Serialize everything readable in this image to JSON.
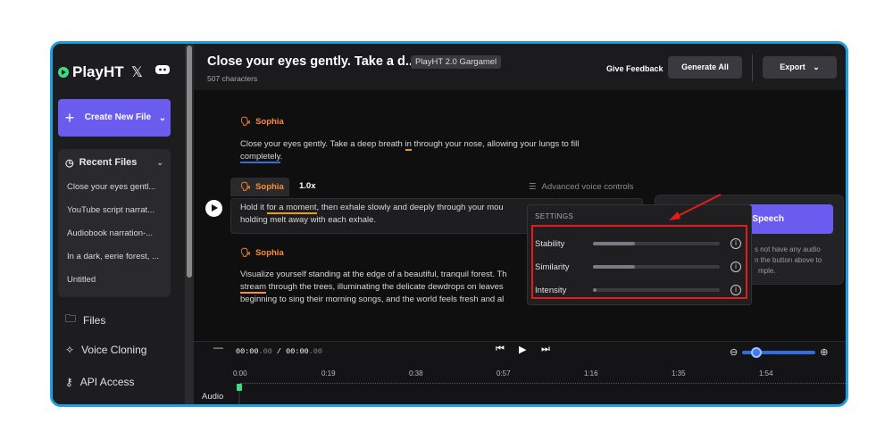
{
  "sidebar": {
    "brand": "PlayHT",
    "create_label": "Create New File",
    "recent_title": "Recent Files",
    "recent_files": [
      "Close your eyes gentl...",
      "YouTube script narrat...",
      "Audiobook narration-...",
      "In a dark, eerie forest, ...",
      "Untitled"
    ],
    "nav": [
      "Files",
      "Voice Cloning",
      "API Access"
    ]
  },
  "header": {
    "title": "Close your eyes gently. Take a d...",
    "model": "PlayHT 2.0 Gargamel",
    "char_count": "507 characters",
    "feedback": "Give Feedback",
    "generate_all": "Generate All",
    "export": "Export"
  },
  "editor": {
    "blocks": [
      {
        "speaker": "Sophia",
        "parts": [
          "Close your eyes gently. Take a deep breath ",
          "in",
          " through your nose, allowing your lungs to fill",
          "completely",
          "."
        ]
      },
      {
        "speaker": "Sophia",
        "speed": "1.0x",
        "parts": [
          "Hold it ",
          "for a moment",
          ", then exhale slowly and deeply through your mou",
          "holding melt away with each exhale."
        ]
      },
      {
        "speaker": "Sophia",
        "parts": [
          "Visualize yourself standing at the edge of a beautiful, tranquil forest. Th",
          "stream",
          " through the trees, illuminating the delicate dewdrops on leaves",
          "beginning to sing their morning songs, and the world feels fresh and al"
        ]
      }
    ],
    "advanced_controls": "Advanced voice controls"
  },
  "right_panel": {
    "button": "Speech",
    "hint_lines": [
      "s not have any audio",
      "n the button above to",
      "mple."
    ]
  },
  "settings": {
    "title": "SETTINGS",
    "rows": [
      {
        "name": "Stability",
        "level": 0.33
      },
      {
        "name": "Similarity",
        "level": 0.33
      },
      {
        "name": "Intensity",
        "level": 0.03
      }
    ]
  },
  "player": {
    "current": "00:00",
    "current_ms": ".00",
    "total": "00:00",
    "total_ms": ".00",
    "ticks": [
      "0:00",
      "0:19",
      "0:38",
      "0:57",
      "1:16",
      "1:35",
      "1:54"
    ],
    "track_label": "Audio"
  },
  "colors": {
    "accent": "#6b5cf0",
    "speaker": "#ff8a3d",
    "frame_border": "#1fa0e0",
    "highlight_box": "#e51c1c"
  }
}
